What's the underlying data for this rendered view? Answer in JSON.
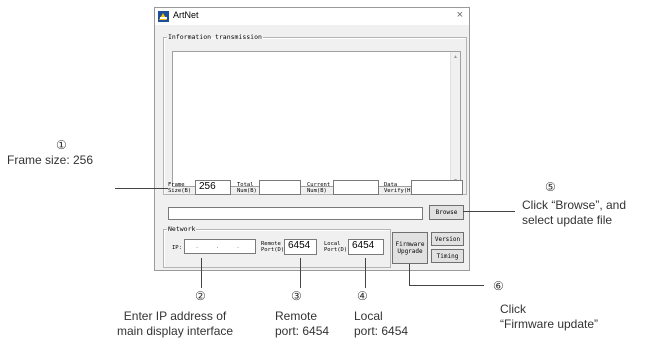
{
  "window": {
    "title": "ArtNet",
    "close_glyph": "×",
    "icon": "artnet-app-icon"
  },
  "info_group": {
    "legend": "Information transmission"
  },
  "stats": {
    "frame_size_label": "Frame\nSize(B)",
    "frame_size_value": "256",
    "total_num_label": "Total\nNum(B)",
    "total_num_value": "",
    "current_num_label": "Current\nNum(B)",
    "current_num_value": "",
    "data_verify_label": "Data\nVerify(H)",
    "data_verify_value": ""
  },
  "file": {
    "path_value": "",
    "browse_label": "Browse"
  },
  "network": {
    "legend": "Network",
    "ip_label": "IP:",
    "ip_value": ". . .",
    "remote_port_label": "Remote\nPort(D)",
    "remote_port_value": "6454",
    "local_port_label": "Local\nPort(D)",
    "local_port_value": "6454"
  },
  "buttons": {
    "firmware_upgrade": "Firmware\nUpgrade",
    "version": "Version",
    "timing": "Timing"
  },
  "annotations": {
    "a1_num": "①",
    "a1_text": "Frame size: 256",
    "a2_num": "②",
    "a2_text": "Enter IP address of\nmain display interface",
    "a3_num": "③",
    "a3_text": "Remote\nport: 6454",
    "a4_num": "④",
    "a4_text": "Local\nport: 6454",
    "a5_num": "⑤",
    "a5_text": "Click “Browse”, and\nselect update file",
    "a6_num": "⑥",
    "a6_text": "Click\n“Firmware update”"
  }
}
